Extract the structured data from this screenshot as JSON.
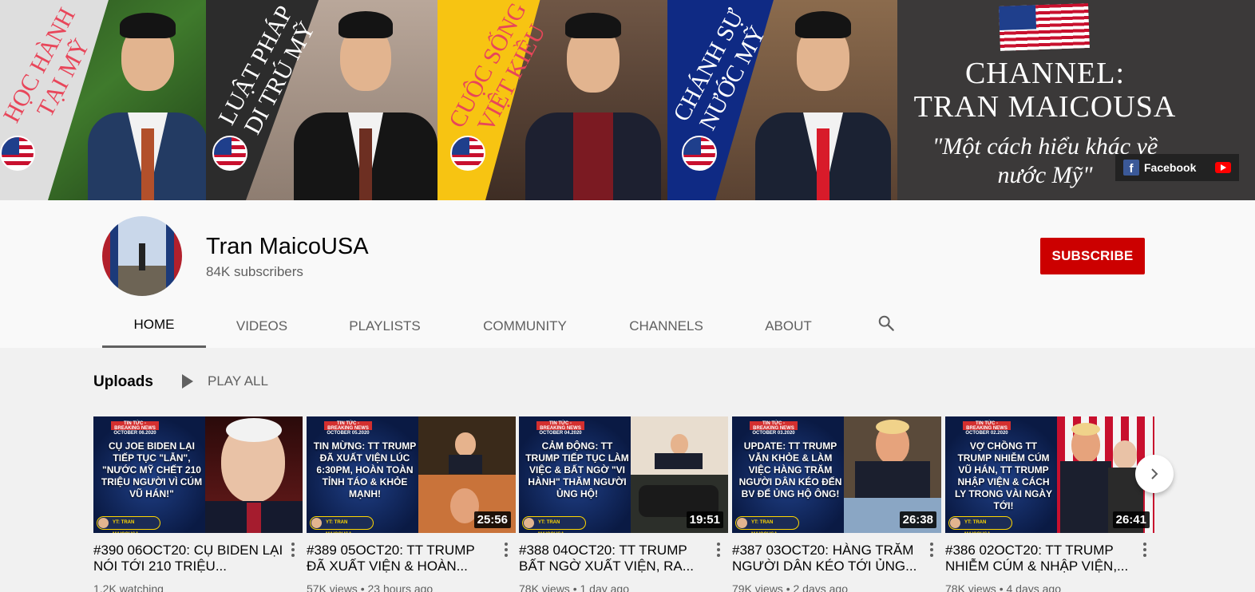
{
  "banner": {
    "panels": [
      {
        "slogan_line1": "HỌC HÀNH",
        "slogan_line2": "TẠI MỸ",
        "slogan_color": "#e8465a"
      },
      {
        "slogan_line1": "LUẬT PHÁP",
        "slogan_line2": "DI TRÚ MỸ",
        "slogan_color": "#ffffff"
      },
      {
        "slogan_line1": "CUỘC SỐNG",
        "slogan_line2": "VIỆT KIỀU",
        "slogan_color": "#e8465a"
      },
      {
        "slogan_line1": "CHÁNH SỰ",
        "slogan_line2": "NƯỚC MỸ",
        "slogan_color": "#ffffff"
      }
    ],
    "channel_line1": "CHANNEL:",
    "channel_line2": "TRAN MAICOUSA",
    "quote_line1": "\"Một cách hiểu khác về",
    "quote_line2": "nước Mỹ\"",
    "links": {
      "facebook_label": "Facebook"
    }
  },
  "channel": {
    "name": "Tran MaicoUSA",
    "subscribers": "84K subscribers",
    "subscribe_label": "SUBSCRIBE"
  },
  "tabs": [
    "HOME",
    "VIDEOS",
    "PLAYLISTS",
    "COMMUNITY",
    "CHANNELS",
    "ABOUT"
  ],
  "active_tab": "HOME",
  "shelf": {
    "title": "Uploads",
    "play_all": "PLAY ALL"
  },
  "videos": [
    {
      "title": "#390 06OCT20: CỤ BIDEN LẠI NÓI TỚI 210 TRIỆU...",
      "meta": "1.2K watching",
      "duration": "",
      "tag": "TIN TỨC - BREAKING NEWS OCTOBER 06.2020",
      "headline": "CỤ JOE BIDEN LẠI TIẾP TỤC \"LẪN\", \"NƯỚC MỸ CHẾT 210 TRIỆU NGƯỜI VÌ CÚM VŨ HÁN!\"",
      "brand": "YT: TRAN MAICOUSA"
    },
    {
      "title": "#389 05OCT20: TT TRUMP ĐÃ XUẤT VIỆN & HOÀN...",
      "meta": "57K views • 23 hours ago",
      "duration": "25:56",
      "tag": "TIN TỨC - BREAKING NEWS OCTOBER 05.2020",
      "headline": "TIN MỪNG: TT TRUMP ĐÃ XUẤT VIỆN LÚC 6:30PM, HOÀN TOÀN TỈNH TÁO & KHỎE MẠNH!",
      "brand": "YT: TRAN MAICOUSA"
    },
    {
      "title": "#388 04OCT20: TT TRUMP BẤT NGỜ XUẤT VIỆN, RA...",
      "meta": "78K views • 1 day ago",
      "duration": "19:51",
      "tag": "TIN TỨC - BREAKING NEWS OCTOBER 04.2020",
      "headline": "CẢM ĐỘNG: TT TRUMP TIẾP TỤC LÀM VIỆC & BẤT NGỜ \"VI HÀNH\" THĂM NGƯỜI ỦNG HỘ!",
      "brand": "YT: TRAN MAICOUSA"
    },
    {
      "title": "#387 03OCT20: HÀNG TRĂM NGƯỜI DÂN KÉO TỚI ỦNG...",
      "meta": "79K views • 2 days ago",
      "duration": "26:38",
      "tag": "TIN TỨC - BREAKING NEWS OCTOBER 03.2020",
      "headline": "UPDATE: TT TRUMP VẪN KHỎE & LÀM VIỆC HÀNG TRĂM NGƯỜI DÂN KÉO ĐẾN BV ĐỂ ỦNG HỘ ÔNG!",
      "brand": "YT: TRAN MAICOUSA"
    },
    {
      "title": "#386 02OCT20: TT TRUMP NHIỄM CÚM & NHẬP VIỆN,...",
      "meta": "78K views • 4 days ago",
      "duration": "26:41",
      "tag": "TIN TỨC - BREAKING NEWS OCTOBER 02.2020",
      "headline": "VỢ CHỒNG TT TRUMP NHIỄM CÚM VŨ HÁN, TT TRUMP NHẬP VIỆN & CÁCH LY TRONG VÀI NGÀY TỚI!",
      "brand": "YT: TRAN MAICOUSA"
    }
  ],
  "colors": {
    "subscribe_red": "#cc0000",
    "page_bg": "#f1f1f1",
    "header_bg": "#f9f9f9",
    "text_secondary": "#606060"
  }
}
